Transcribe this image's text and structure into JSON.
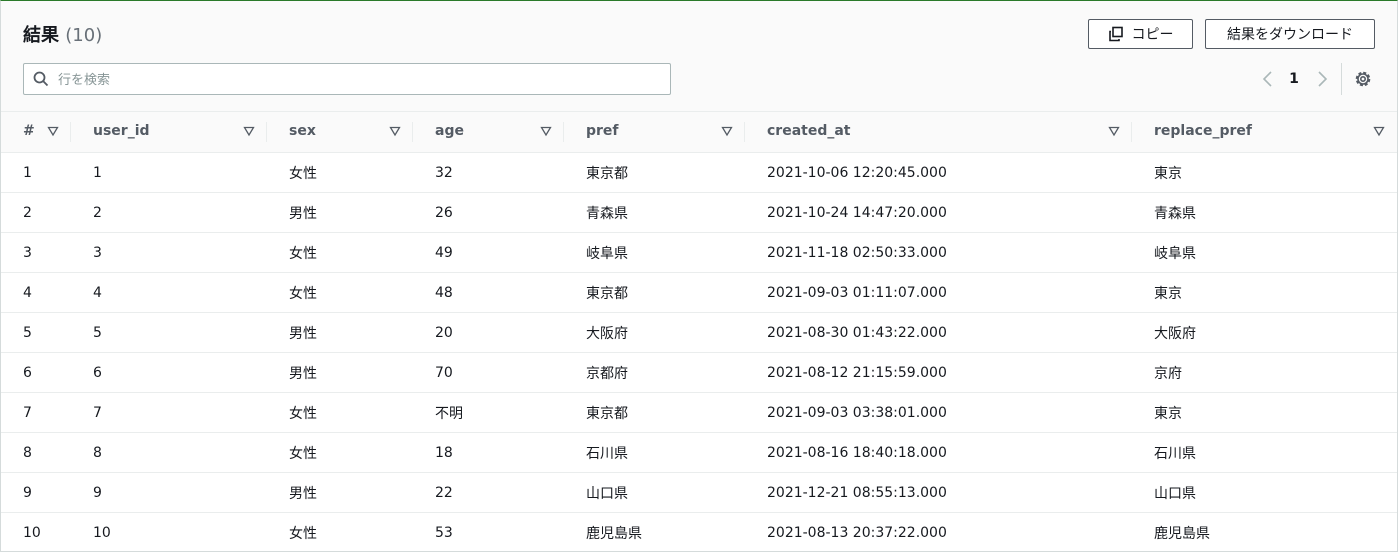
{
  "header": {
    "title": "結果",
    "count": "(10)",
    "copy_label": "コピー",
    "download_label": "結果をダウンロード"
  },
  "search": {
    "placeholder": "行を検索",
    "value": ""
  },
  "pagination": {
    "current_page": "1"
  },
  "table": {
    "columns": [
      "#",
      "user_id",
      "sex",
      "age",
      "pref",
      "created_at",
      "replace_pref"
    ],
    "rows": [
      [
        "1",
        "1",
        "女性",
        "32",
        "東京都",
        "2021-10-06 12:20:45.000",
        "東京"
      ],
      [
        "2",
        "2",
        "男性",
        "26",
        "青森県",
        "2021-10-24 14:47:20.000",
        "青森県"
      ],
      [
        "3",
        "3",
        "女性",
        "49",
        "岐阜県",
        "2021-11-18 02:50:33.000",
        "岐阜県"
      ],
      [
        "4",
        "4",
        "女性",
        "48",
        "東京都",
        "2021-09-03 01:11:07.000",
        "東京"
      ],
      [
        "5",
        "5",
        "男性",
        "20",
        "大阪府",
        "2021-08-30 01:43:22.000",
        "大阪府"
      ],
      [
        "6",
        "6",
        "男性",
        "70",
        "京都府",
        "2021-08-12 21:15:59.000",
        "京府"
      ],
      [
        "7",
        "7",
        "女性",
        "不明",
        "東京都",
        "2021-09-03 03:38:01.000",
        "東京"
      ],
      [
        "8",
        "8",
        "女性",
        "18",
        "石川県",
        "2021-08-16 18:40:18.000",
        "石川県"
      ],
      [
        "9",
        "9",
        "男性",
        "22",
        "山口県",
        "2021-12-21 08:55:13.000",
        "山口県"
      ],
      [
        "10",
        "10",
        "女性",
        "53",
        "鹿児島県",
        "2021-08-13 20:37:22.000",
        "鹿児島県"
      ]
    ]
  },
  "colors": {
    "accent_border": "#2a7a2a",
    "header_bg": "#fafafa",
    "text": "#16191f"
  }
}
